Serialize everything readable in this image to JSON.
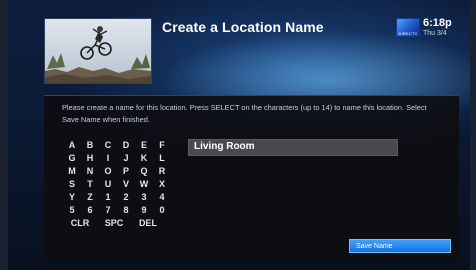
{
  "header": {
    "title": "Create a Location Name",
    "logo_text": "DIRECTV",
    "time": "6:18p",
    "date": "Thu 3/4"
  },
  "instructions": "Please create a name for this location. Press SELECT on the characters (up to 14) to name this location. Select Save Name when finished.",
  "keyboard": {
    "rows": [
      [
        "A",
        "B",
        "C",
        "D",
        "E",
        "F"
      ],
      [
        "G",
        "H",
        "I",
        "J",
        "K",
        "L"
      ],
      [
        "M",
        "N",
        "O",
        "P",
        "Q",
        "R"
      ],
      [
        "S",
        "T",
        "U",
        "V",
        "W",
        "X"
      ],
      [
        "Y",
        "Z",
        "1",
        "2",
        "3",
        "4"
      ],
      [
        "5",
        "6",
        "7",
        "8",
        "9",
        "0"
      ],
      [
        "CLR",
        "SPC",
        "DEL"
      ]
    ]
  },
  "name_field": {
    "value": "Living Room"
  },
  "save_button": {
    "label": "Save Name"
  },
  "colors": {
    "accent": "#2a86f0",
    "panel": "#0e0e12",
    "field": "#4a4a4e"
  },
  "preview": {
    "icon": "bmx-rider-video-preview"
  }
}
